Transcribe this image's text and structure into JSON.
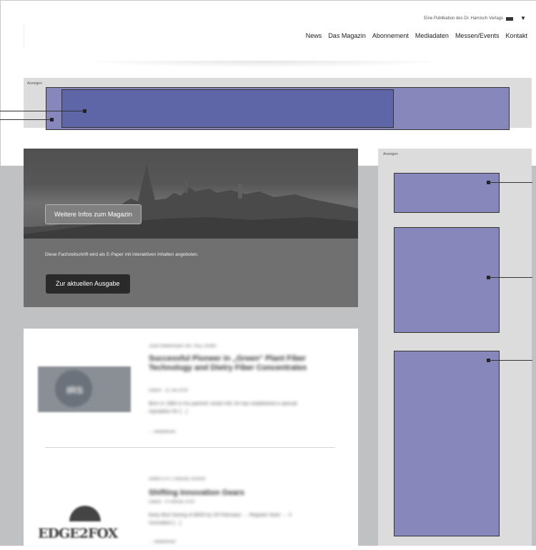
{
  "header": {
    "publisher_line": "Eine Publikation des Dr. Harnisch Verlags",
    "language_icon": "flag-icon",
    "nav": [
      "News",
      "Das Magazin",
      "Abonnement",
      "Mediadaten",
      "Messen/Events",
      "Kontakt"
    ]
  },
  "ads": {
    "top_label": "Anzeigen",
    "sidebar_label": "Anzeigen"
  },
  "hero": {
    "info_button": "Weitere Infos zum Magazin",
    "description": "Diese Fachzeitschrift wird als E-Paper mit interaktiven Inhalten angeboten.",
    "cta_button": "Zur aktuellen Ausgabe"
  },
  "articles": [
    {
      "meta": "Josef Rettenmaier sen. REE GmbH",
      "title": "Successful Pioneer in „Green“ Plant Fiber Technology and Dietry Fiber Concentrates",
      "date": "Datum · 11 Juli 2019",
      "excerpt": "Born in 1884 in his parents' wood mill, he has established a special reputation for […]",
      "more": "… weiterlesen",
      "thumb_label": "IRS"
    },
    {
      "meta": "Artikel D in 1 Industry Summit",
      "title": "Shifting Innovation Gears",
      "date": "Datum · 4 Februar 2019",
      "excerpt": "Early Bird Saving of $500 by 28 February! → Register Now! → 3 Innovation […]",
      "more": "… weiterlesen",
      "thumb_label": "EDGE2FOX"
    }
  ],
  "colors": {
    "ad_placeholder": "#8787bb",
    "ad_placeholder_dark": "#5f66a8",
    "band_gray": "#c0c1c3",
    "sidebar_gray": "#dcdcdc"
  }
}
